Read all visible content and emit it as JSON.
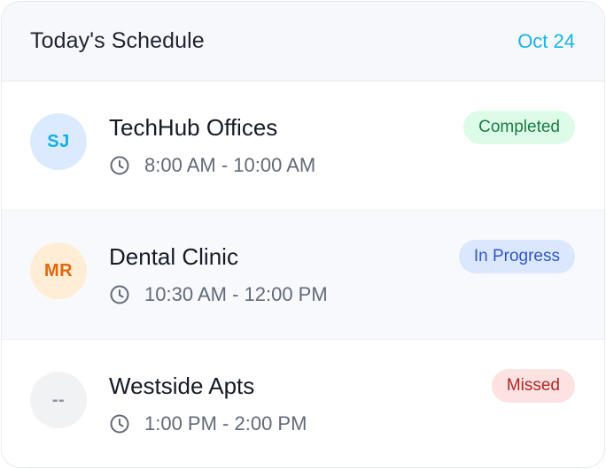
{
  "header": {
    "title": "Today's Schedule",
    "date": "Oct 24"
  },
  "rows": [
    {
      "initials": "SJ",
      "avatar_bg": "#dbeafe",
      "avatar_color": "#14aee8",
      "name": "TechHub Offices",
      "time": "8:00 AM - 10:00 AM",
      "status": "Completed",
      "status_bg": "#dcfce7",
      "status_color": "#1b7a45",
      "highlighted": false
    },
    {
      "initials": "MR",
      "avatar_bg": "#ffedd5",
      "avatar_color": "#e2660f",
      "name": "Dental Clinic",
      "time": "10:30 AM - 12:00 PM",
      "status": "In Progress",
      "status_bg": "#dbe7fd",
      "status_color": "#2f57c9",
      "highlighted": true
    },
    {
      "initials": "--",
      "avatar_bg": "#f1f2f4",
      "avatar_color": "#8b919c",
      "name": "Westside Apts",
      "time": "1:00 PM - 2:00 PM",
      "status": "Missed",
      "status_bg": "#fde2e2",
      "status_color": "#b42323",
      "highlighted": false
    }
  ],
  "icons": {
    "time": "clock-icon"
  }
}
